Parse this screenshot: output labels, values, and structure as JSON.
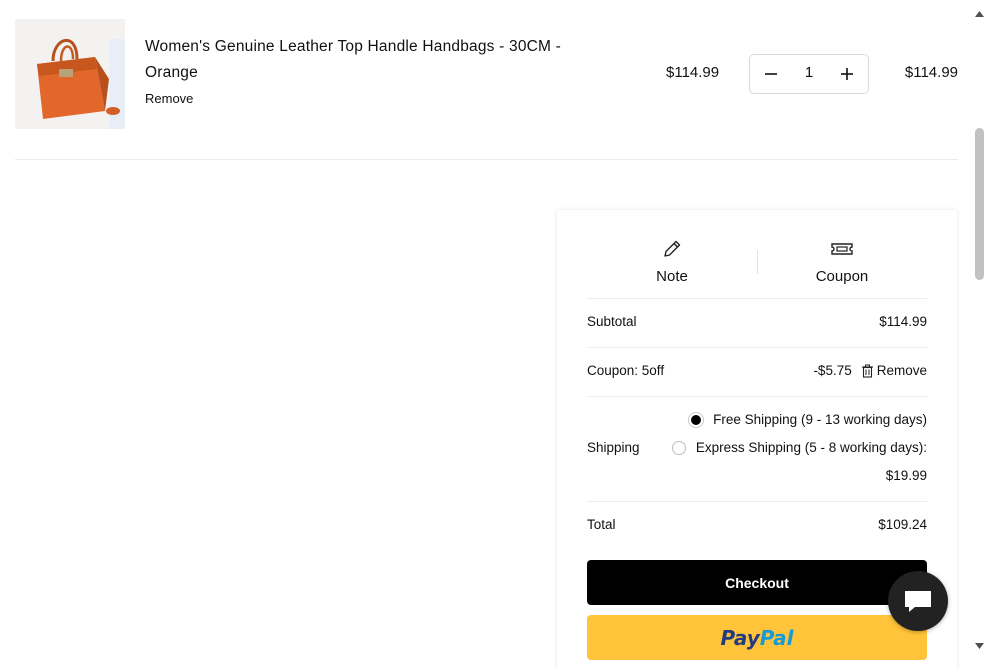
{
  "cart_item": {
    "name": "Women's Genuine Leather Top Handle Handbags - 30CM - Orange",
    "remove_label": "Remove",
    "unit_price": "$114.99",
    "quantity": "1",
    "line_total": "$114.99",
    "image_icon": "orange-handbag-image"
  },
  "summary": {
    "tabs": [
      {
        "label": "Note",
        "icon": "pencil-icon"
      },
      {
        "label": "Coupon",
        "icon": "ticket-icon"
      }
    ],
    "subtotal_label": "Subtotal",
    "subtotal_value": "$114.99",
    "coupon_label": "Coupon: 5off",
    "coupon_value": "-$5.75",
    "coupon_remove_label": "Remove",
    "shipping_label": "Shipping",
    "shipping_options": [
      {
        "label": "Free Shipping (9 - 13 working days)",
        "selected": true
      },
      {
        "label": "Express Shipping (5 - 8 working days):",
        "price": "$19.99",
        "selected": false
      }
    ],
    "total_label": "Total",
    "total_value": "$109.24",
    "checkout_label": "Checkout",
    "paypal_label_pay": "Pay",
    "paypal_label_pal": "Pal"
  },
  "colors": {
    "checkout_bg": "#000000",
    "paypal_bg": "#ffc439",
    "paypal_dark": "#253b80",
    "paypal_light": "#179bd7",
    "product_orange": "#e0692f"
  }
}
